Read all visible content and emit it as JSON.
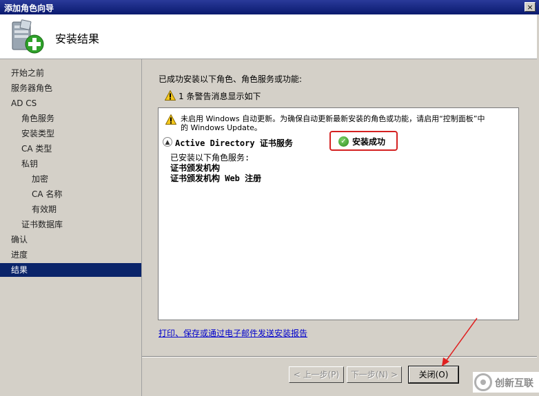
{
  "window": {
    "title": "添加角色向导",
    "close_glyph": "×"
  },
  "header": {
    "title": "安装结果",
    "icon": "server-add-icon"
  },
  "sidebar": {
    "items": [
      {
        "label": "开始之前",
        "level": 1
      },
      {
        "label": "服务器角色",
        "level": 1
      },
      {
        "label": "AD CS",
        "level": 1
      },
      {
        "label": "角色服务",
        "level": 2
      },
      {
        "label": "安装类型",
        "level": 2
      },
      {
        "label": "CA 类型",
        "level": 2
      },
      {
        "label": "私钥",
        "level": 2
      },
      {
        "label": "加密",
        "level": 3
      },
      {
        "label": "CA 名称",
        "level": 3
      },
      {
        "label": "有效期",
        "level": 3
      },
      {
        "label": "证书数据库",
        "level": 2
      },
      {
        "label": "确认",
        "level": 1
      },
      {
        "label": "进度",
        "level": 1
      },
      {
        "label": "结果",
        "level": 1,
        "active": true
      }
    ]
  },
  "main": {
    "summary": "已成功安装以下角色、角色服务或功能:",
    "warning_summary": "1 条警告消息显示如下",
    "results": {
      "warning_line1": "未启用 Windows 自动更新。为确保自动更新最新安装的角色或功能，请启用“控制面板”中",
      "warning_line2": "的 Windows Update。",
      "section_title": "Active Directory 证书服务",
      "status": "安装成功",
      "installed_header": "已安装以下角色服务:",
      "services": [
        "证书颁发机构",
        "证书颁发机构 Web 注册"
      ]
    },
    "report_link": "打印、保存或通过电子邮件发送安装报告"
  },
  "buttons": {
    "prev": "< 上一步(P)",
    "next": "下一步(N) >",
    "close": "关闭(O)"
  },
  "watermark": {
    "text": "创新互联"
  },
  "colors": {
    "selection": "#0a246a",
    "success": "#2a8a1c",
    "highlight_border": "#d42020",
    "arrow": "#e02020",
    "link": "#0000cc"
  }
}
